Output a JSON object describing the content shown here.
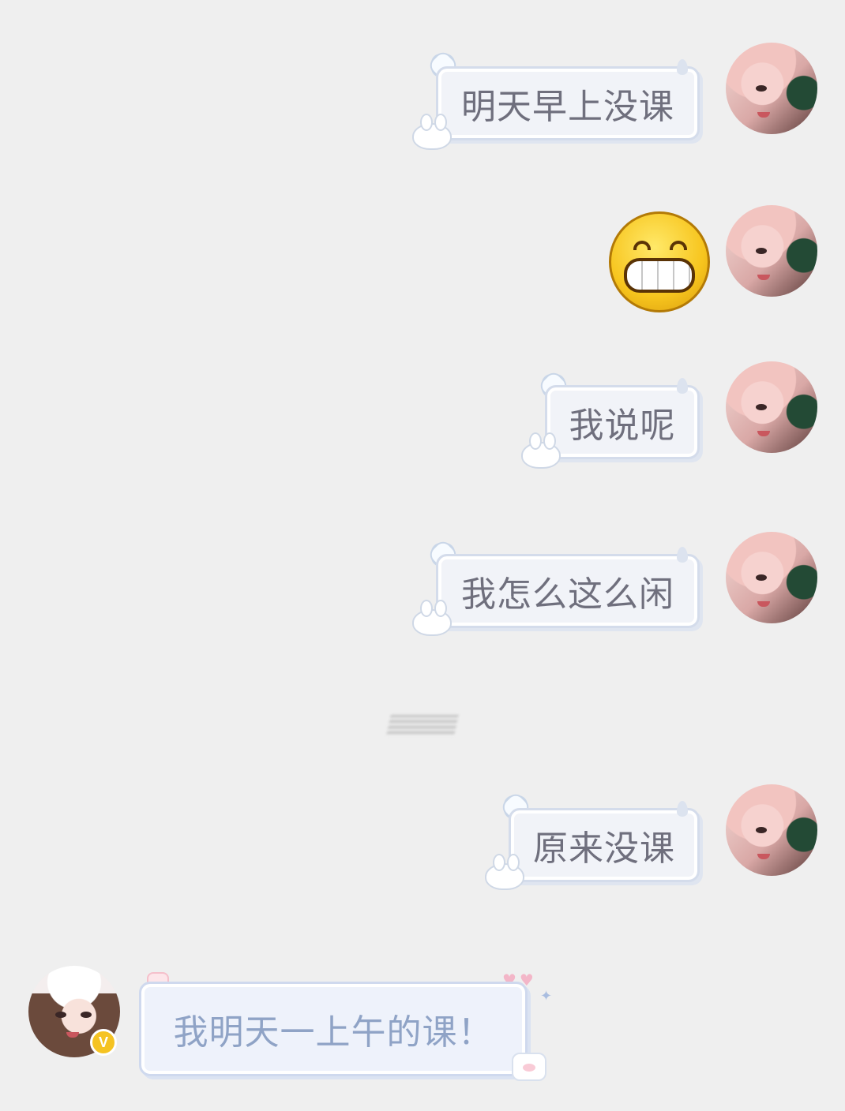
{
  "messages": [
    {
      "side": "right",
      "type": "text",
      "text": "明天早上没课"
    },
    {
      "side": "right",
      "type": "emoji",
      "emoji": "grinning-face"
    },
    {
      "side": "right",
      "type": "text",
      "text": "我说呢"
    },
    {
      "side": "right",
      "type": "text",
      "text": "我怎么这么闲"
    },
    {
      "side": "right",
      "type": "text",
      "text": "原来没课"
    },
    {
      "side": "left",
      "type": "text",
      "text": "我明天一上午的课！",
      "badge": "V"
    }
  ],
  "colors": {
    "background": "#efefef",
    "right_bubble": "#f1f3f8",
    "left_bubble_text": "#8fa3c6",
    "vip_badge": "#f5c322"
  }
}
